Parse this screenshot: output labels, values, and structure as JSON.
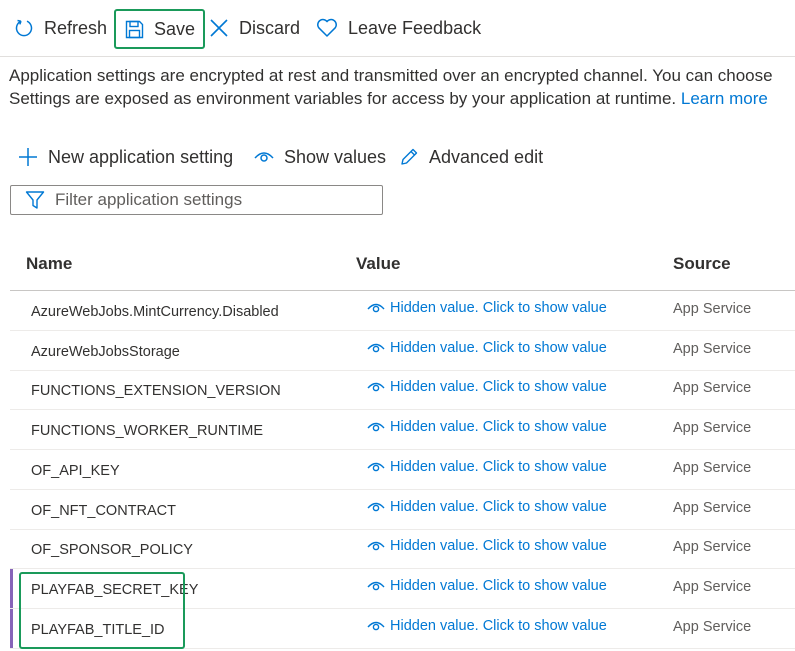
{
  "toolbar": {
    "refresh_label": "Refresh",
    "save_label": "Save",
    "discard_label": "Discard",
    "feedback_label": "Leave Feedback"
  },
  "description": {
    "line1": "Application settings are encrypted at rest and transmitted over an encrypted channel. You can choose",
    "line2": "Settings are exposed as environment variables for access by your application at runtime.",
    "link": "Learn more"
  },
  "actions": {
    "new_label": "New application setting",
    "show_label": "Show values",
    "advanced_label": "Advanced edit"
  },
  "filter": {
    "placeholder": "Filter application settings"
  },
  "table": {
    "headers": {
      "name": "Name",
      "value": "Value",
      "source": "Source"
    },
    "rows": [
      {
        "name": "AzureWebJobs.MintCurrency.Disabled",
        "value": "Hidden value. Click to show value",
        "source": "App Service"
      },
      {
        "name": "AzureWebJobsStorage",
        "value": "Hidden value. Click to show value",
        "source": "App Service"
      },
      {
        "name": "FUNCTIONS_EXTENSION_VERSION",
        "value": "Hidden value. Click to show value",
        "source": "App Service"
      },
      {
        "name": "FUNCTIONS_WORKER_RUNTIME",
        "value": "Hidden value. Click to show value",
        "source": "App Service"
      },
      {
        "name": "OF_API_KEY",
        "value": "Hidden value. Click to show value",
        "source": "App Service"
      },
      {
        "name": "OF_NFT_CONTRACT",
        "value": "Hidden value. Click to show value",
        "source": "App Service"
      },
      {
        "name": "OF_SPONSOR_POLICY",
        "value": "Hidden value. Click to show value",
        "source": "App Service"
      },
      {
        "name": "PLAYFAB_SECRET_KEY",
        "value": "Hidden value. Click to show value",
        "source": "App Service"
      },
      {
        "name": "PLAYFAB_TITLE_ID",
        "value": "Hidden value. Click to show value",
        "source": "App Service"
      }
    ]
  },
  "colors": {
    "accent": "#0078d4",
    "highlight": "#1a9a5a",
    "new_marker": "#8764b8"
  }
}
